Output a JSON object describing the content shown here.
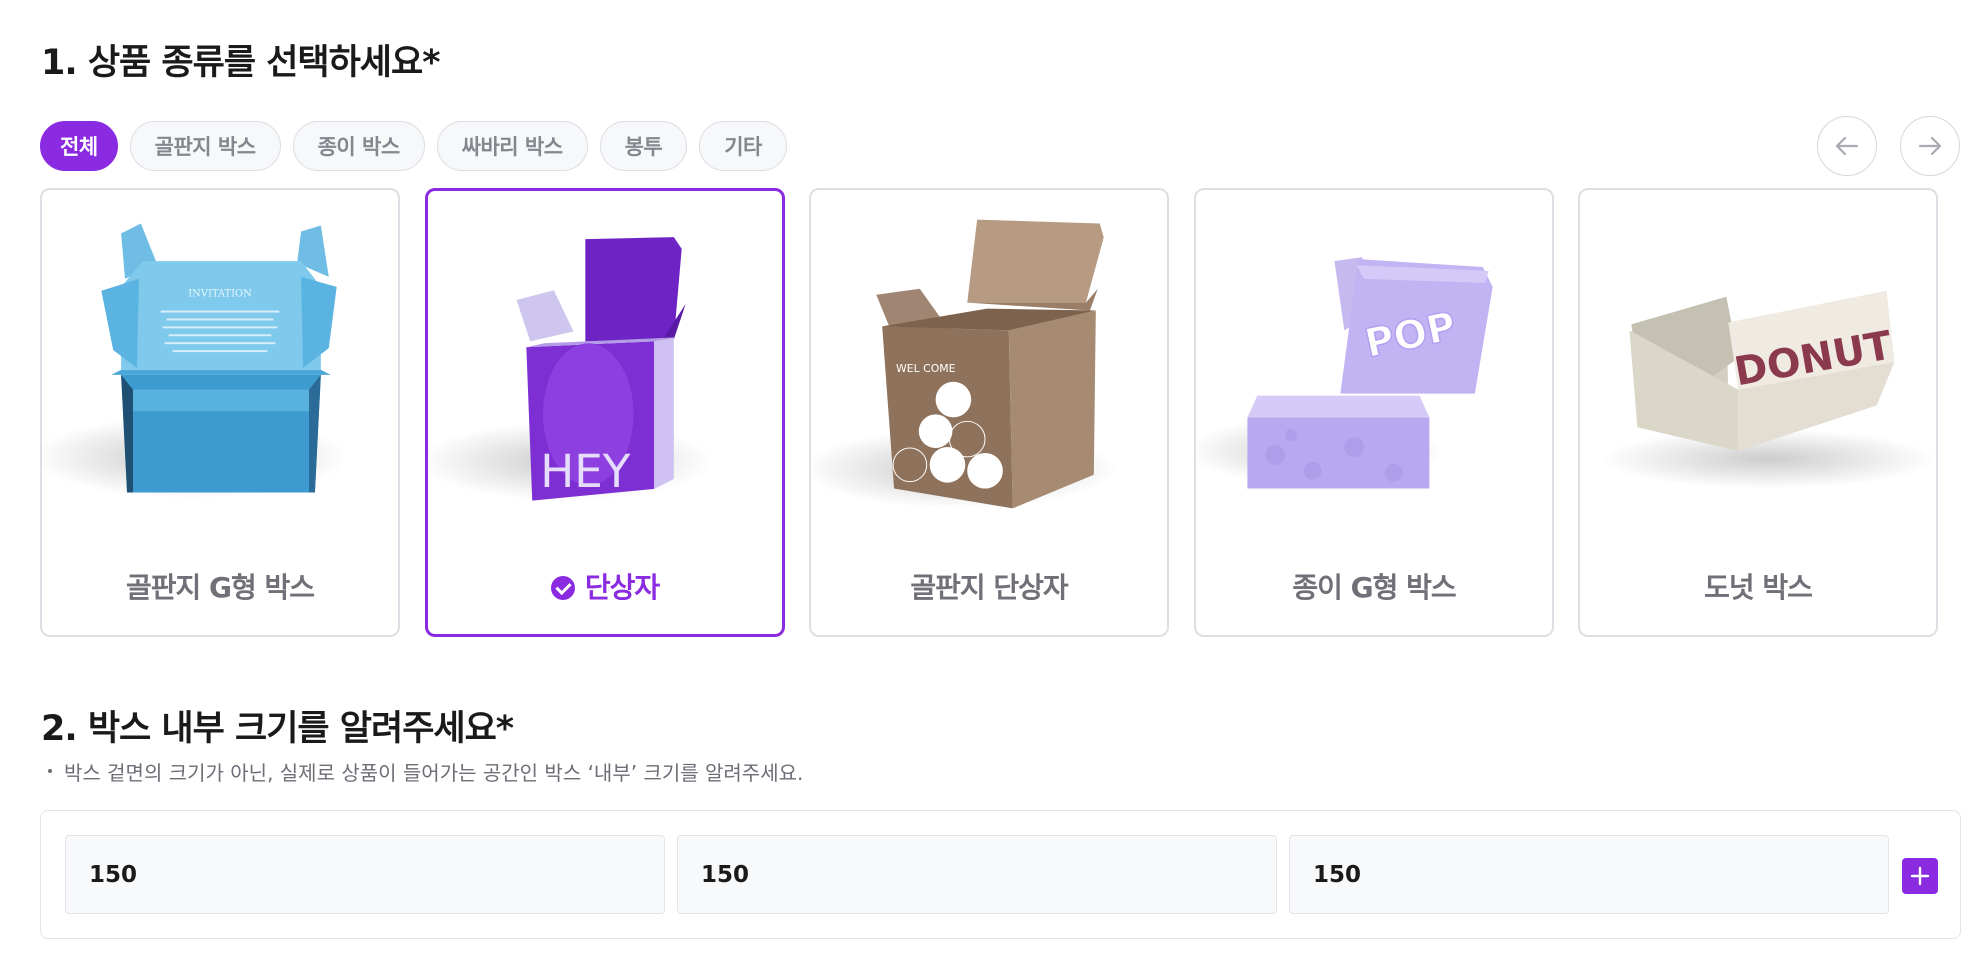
{
  "section1": {
    "title": "1. 상품 종류를 선택하세요*"
  },
  "filters": [
    "전체",
    "골판지 박스",
    "종이 박스",
    "싸바리 박스",
    "봉투",
    "기타"
  ],
  "active_filter": "전체",
  "nav": {
    "prev_icon": "arrow-left-icon",
    "next_icon": "arrow-right-icon"
  },
  "products": [
    {
      "name": "골판지 G형 박스",
      "selected": false,
      "art_text": "INVITATION"
    },
    {
      "name": "단상자",
      "selected": true,
      "art_text": "HEY"
    },
    {
      "name": "골판지 단상자",
      "selected": false,
      "art_text": "WEL COME"
    },
    {
      "name": "종이 G형 박스",
      "selected": false,
      "art_text": "POP"
    },
    {
      "name": "도넛 박스",
      "selected": false,
      "art_text": "DONUT"
    }
  ],
  "section2": {
    "title": "2. 박스 내부 크기를 알려주세요*",
    "description": "박스 겉면의 크기가 아닌, 실제로 상품이 들어가는 공간인 박스 ‘내부’ 크기를 알려주세요."
  },
  "size_inputs": [
    "150",
    "150",
    "150"
  ],
  "colors": {
    "accent": "#8a2be2",
    "chip_border": "#dcdde3",
    "card_border": "#dedfe5",
    "muted_text": "#6f7078"
  },
  "icons": {
    "add": "plus-icon",
    "selected": "check-circle-icon"
  }
}
